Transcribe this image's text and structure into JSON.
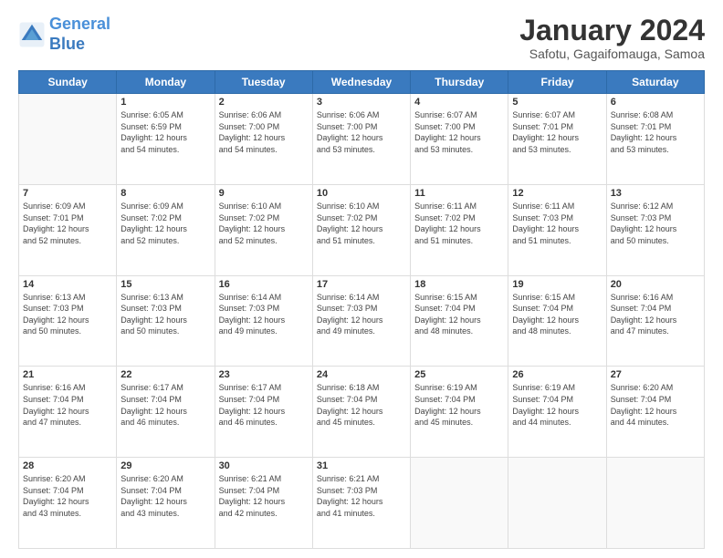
{
  "logo": {
    "line1": "General",
    "line2": "Blue"
  },
  "title": "January 2024",
  "subtitle": "Safotu, Gagaifomauga, Samoa",
  "weekdays": [
    "Sunday",
    "Monday",
    "Tuesday",
    "Wednesday",
    "Thursday",
    "Friday",
    "Saturday"
  ],
  "weeks": [
    [
      {
        "day": "",
        "info": ""
      },
      {
        "day": "1",
        "info": "Sunrise: 6:05 AM\nSunset: 6:59 PM\nDaylight: 12 hours\nand 54 minutes."
      },
      {
        "day": "2",
        "info": "Sunrise: 6:06 AM\nSunset: 7:00 PM\nDaylight: 12 hours\nand 54 minutes."
      },
      {
        "day": "3",
        "info": "Sunrise: 6:06 AM\nSunset: 7:00 PM\nDaylight: 12 hours\nand 53 minutes."
      },
      {
        "day": "4",
        "info": "Sunrise: 6:07 AM\nSunset: 7:00 PM\nDaylight: 12 hours\nand 53 minutes."
      },
      {
        "day": "5",
        "info": "Sunrise: 6:07 AM\nSunset: 7:01 PM\nDaylight: 12 hours\nand 53 minutes."
      },
      {
        "day": "6",
        "info": "Sunrise: 6:08 AM\nSunset: 7:01 PM\nDaylight: 12 hours\nand 53 minutes."
      }
    ],
    [
      {
        "day": "7",
        "info": "Sunrise: 6:09 AM\nSunset: 7:01 PM\nDaylight: 12 hours\nand 52 minutes."
      },
      {
        "day": "8",
        "info": "Sunrise: 6:09 AM\nSunset: 7:02 PM\nDaylight: 12 hours\nand 52 minutes."
      },
      {
        "day": "9",
        "info": "Sunrise: 6:10 AM\nSunset: 7:02 PM\nDaylight: 12 hours\nand 52 minutes."
      },
      {
        "day": "10",
        "info": "Sunrise: 6:10 AM\nSunset: 7:02 PM\nDaylight: 12 hours\nand 51 minutes."
      },
      {
        "day": "11",
        "info": "Sunrise: 6:11 AM\nSunset: 7:02 PM\nDaylight: 12 hours\nand 51 minutes."
      },
      {
        "day": "12",
        "info": "Sunrise: 6:11 AM\nSunset: 7:03 PM\nDaylight: 12 hours\nand 51 minutes."
      },
      {
        "day": "13",
        "info": "Sunrise: 6:12 AM\nSunset: 7:03 PM\nDaylight: 12 hours\nand 50 minutes."
      }
    ],
    [
      {
        "day": "14",
        "info": "Sunrise: 6:13 AM\nSunset: 7:03 PM\nDaylight: 12 hours\nand 50 minutes."
      },
      {
        "day": "15",
        "info": "Sunrise: 6:13 AM\nSunset: 7:03 PM\nDaylight: 12 hours\nand 50 minutes."
      },
      {
        "day": "16",
        "info": "Sunrise: 6:14 AM\nSunset: 7:03 PM\nDaylight: 12 hours\nand 49 minutes."
      },
      {
        "day": "17",
        "info": "Sunrise: 6:14 AM\nSunset: 7:03 PM\nDaylight: 12 hours\nand 49 minutes."
      },
      {
        "day": "18",
        "info": "Sunrise: 6:15 AM\nSunset: 7:04 PM\nDaylight: 12 hours\nand 48 minutes."
      },
      {
        "day": "19",
        "info": "Sunrise: 6:15 AM\nSunset: 7:04 PM\nDaylight: 12 hours\nand 48 minutes."
      },
      {
        "day": "20",
        "info": "Sunrise: 6:16 AM\nSunset: 7:04 PM\nDaylight: 12 hours\nand 47 minutes."
      }
    ],
    [
      {
        "day": "21",
        "info": "Sunrise: 6:16 AM\nSunset: 7:04 PM\nDaylight: 12 hours\nand 47 minutes."
      },
      {
        "day": "22",
        "info": "Sunrise: 6:17 AM\nSunset: 7:04 PM\nDaylight: 12 hours\nand 46 minutes."
      },
      {
        "day": "23",
        "info": "Sunrise: 6:17 AM\nSunset: 7:04 PM\nDaylight: 12 hours\nand 46 minutes."
      },
      {
        "day": "24",
        "info": "Sunrise: 6:18 AM\nSunset: 7:04 PM\nDaylight: 12 hours\nand 45 minutes."
      },
      {
        "day": "25",
        "info": "Sunrise: 6:19 AM\nSunset: 7:04 PM\nDaylight: 12 hours\nand 45 minutes."
      },
      {
        "day": "26",
        "info": "Sunrise: 6:19 AM\nSunset: 7:04 PM\nDaylight: 12 hours\nand 44 minutes."
      },
      {
        "day": "27",
        "info": "Sunrise: 6:20 AM\nSunset: 7:04 PM\nDaylight: 12 hours\nand 44 minutes."
      }
    ],
    [
      {
        "day": "28",
        "info": "Sunrise: 6:20 AM\nSunset: 7:04 PM\nDaylight: 12 hours\nand 43 minutes."
      },
      {
        "day": "29",
        "info": "Sunrise: 6:20 AM\nSunset: 7:04 PM\nDaylight: 12 hours\nand 43 minutes."
      },
      {
        "day": "30",
        "info": "Sunrise: 6:21 AM\nSunset: 7:04 PM\nDaylight: 12 hours\nand 42 minutes."
      },
      {
        "day": "31",
        "info": "Sunrise: 6:21 AM\nSunset: 7:03 PM\nDaylight: 12 hours\nand 41 minutes."
      },
      {
        "day": "",
        "info": ""
      },
      {
        "day": "",
        "info": ""
      },
      {
        "day": "",
        "info": ""
      }
    ]
  ]
}
